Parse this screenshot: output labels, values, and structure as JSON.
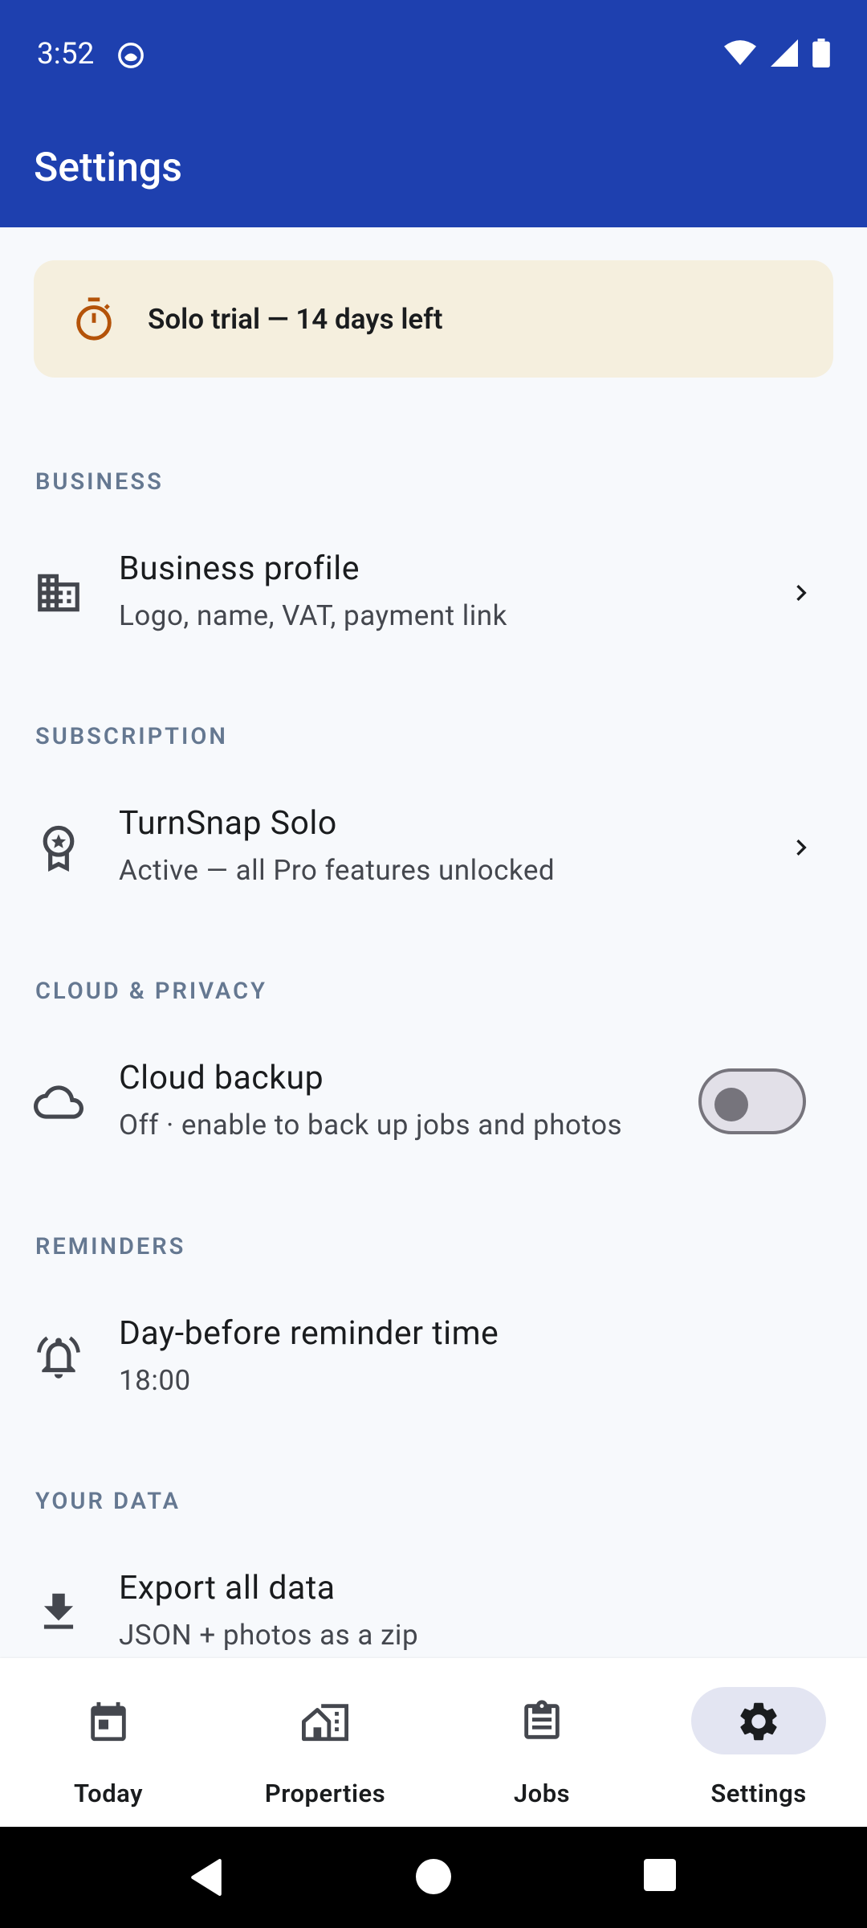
{
  "status": {
    "time": "3:52"
  },
  "appbar": {
    "title": "Settings"
  },
  "trial": {
    "text": "Solo trial — 14 days left"
  },
  "sections": {
    "business": {
      "header": "BUSINESS",
      "item": {
        "title": "Business profile",
        "subtitle": "Logo, name, VAT, payment link"
      }
    },
    "subscription": {
      "header": "SUBSCRIPTION",
      "item": {
        "title": "TurnSnap Solo",
        "subtitle": "Active — all Pro features unlocked"
      }
    },
    "cloud": {
      "header": "CLOUD & PRIVACY",
      "item": {
        "title": "Cloud backup",
        "subtitle": "Off · enable to back up jobs and photos",
        "toggle_on": false
      }
    },
    "reminders": {
      "header": "REMINDERS",
      "item": {
        "title": "Day-before reminder time",
        "subtitle": "18:00"
      }
    },
    "data": {
      "header": "YOUR DATA",
      "item": {
        "title": "Export all data",
        "subtitle": "JSON + photos as a zip"
      }
    }
  },
  "nav": {
    "items": [
      {
        "label": "Today",
        "icon": "calendar-icon",
        "active": false
      },
      {
        "label": "Properties",
        "icon": "properties-icon",
        "active": false
      },
      {
        "label": "Jobs",
        "icon": "clipboard-icon",
        "active": false
      },
      {
        "label": "Settings",
        "icon": "gear-icon",
        "active": true
      }
    ]
  },
  "colors": {
    "appbar": "#1e40af",
    "trial_bg": "#f5efde",
    "trial_icon": "#b45309",
    "section_header": "#657891",
    "active_pill": "#e3e5f2"
  }
}
